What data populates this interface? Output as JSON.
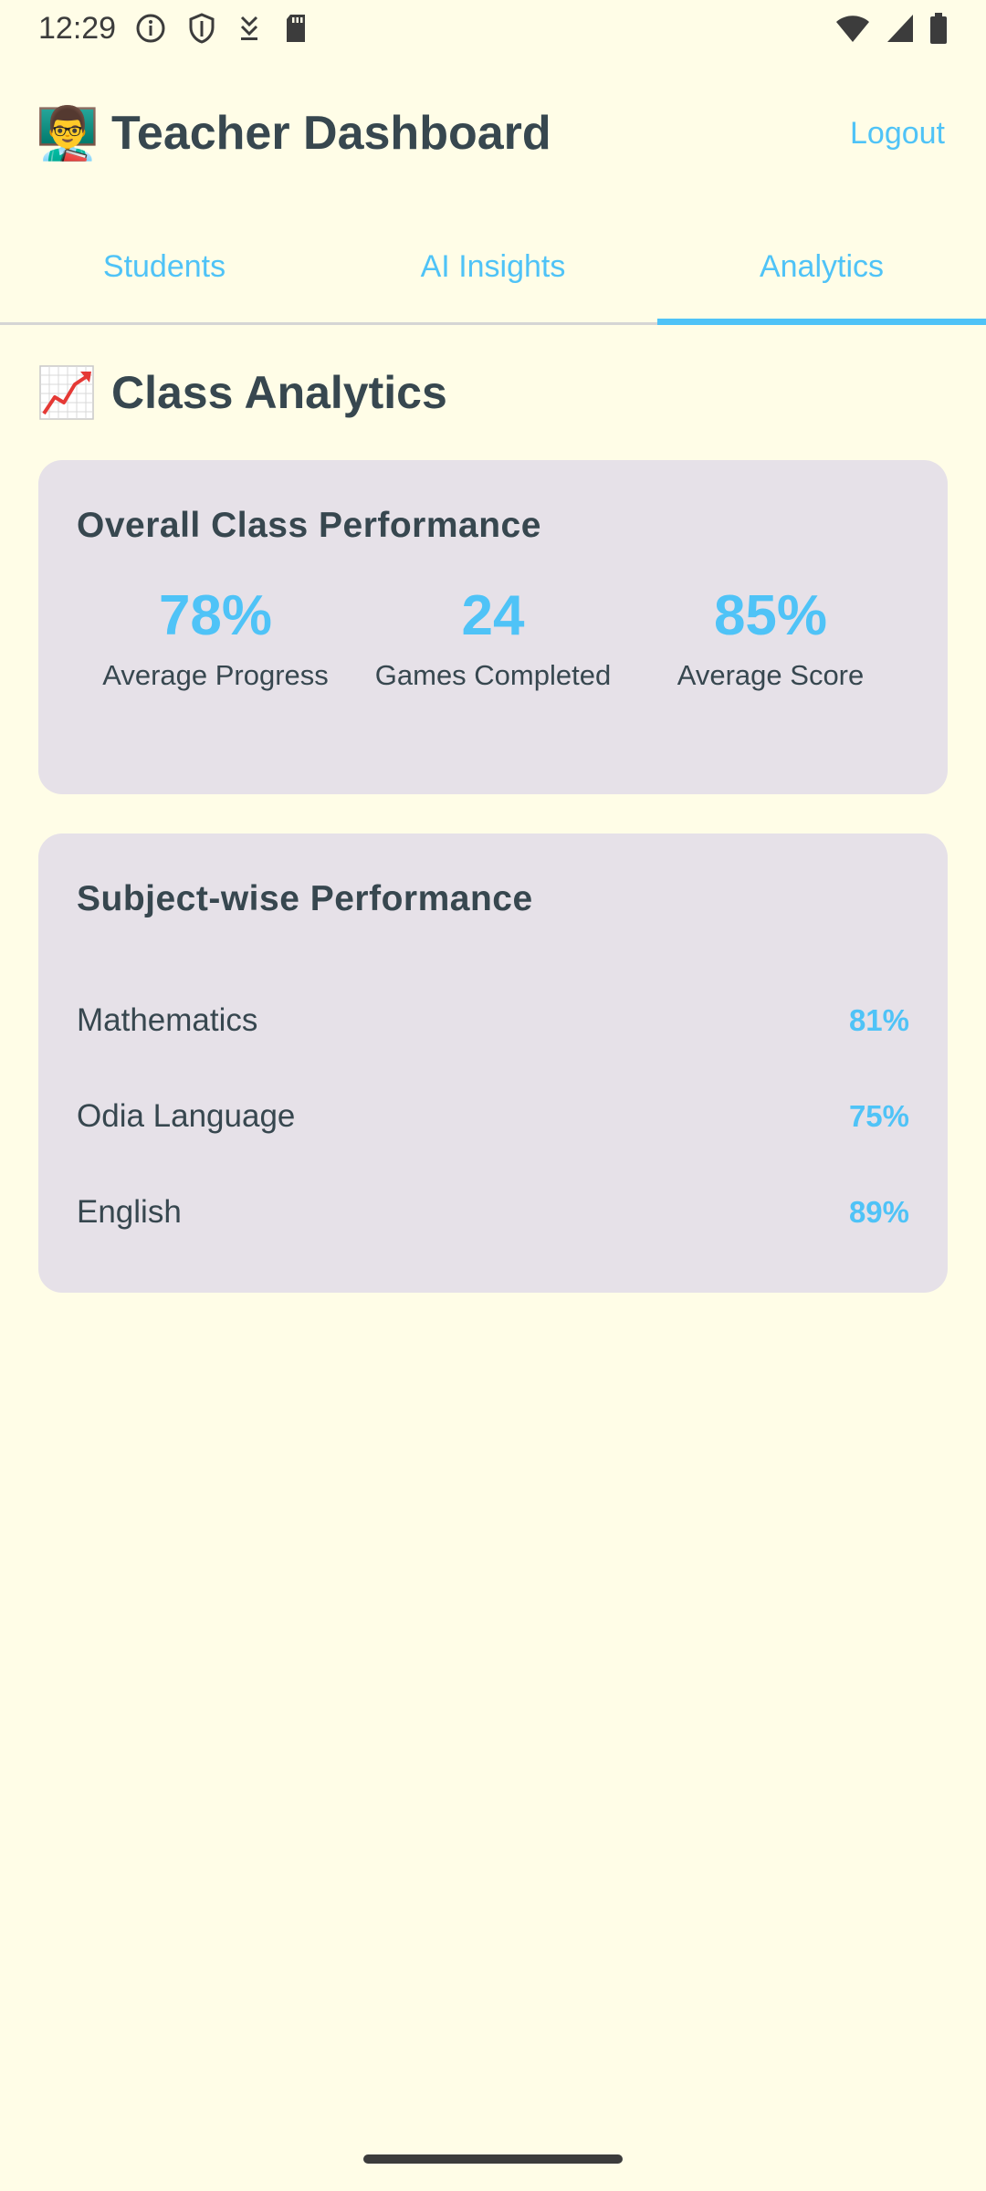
{
  "status_bar": {
    "time": "12:29",
    "left_icons": [
      "info-icon",
      "shield-icon",
      "download-icon",
      "sd-card-icon"
    ],
    "right_icons": [
      "wifi-icon",
      "signal-icon",
      "battery-icon"
    ]
  },
  "header": {
    "emoji": "👨‍🏫",
    "title": "Teacher Dashboard",
    "logout_label": "Logout"
  },
  "tabs": [
    {
      "label": "Students",
      "active": false
    },
    {
      "label": "AI Insights",
      "active": false
    },
    {
      "label": "Analytics",
      "active": true
    }
  ],
  "section": {
    "icon": "chart-increasing-icon",
    "title": "Class Analytics"
  },
  "overall_card": {
    "title": "Overall Class Performance",
    "stats": [
      {
        "value": "78%",
        "label": "Average Progress"
      },
      {
        "value": "24",
        "label": "Games Completed"
      },
      {
        "value": "85%",
        "label": "Average Score"
      }
    ]
  },
  "subject_card": {
    "title": "Subject-wise Performance",
    "subjects": [
      {
        "name": "Mathematics",
        "score": "81%"
      },
      {
        "name": "Odia Language",
        "score": "75%"
      },
      {
        "name": "English",
        "score": "89%"
      }
    ]
  },
  "colors": {
    "background": "#fffde7",
    "accent": "#4fc3f7",
    "card": "#e6e1e8",
    "text": "#37474f"
  }
}
